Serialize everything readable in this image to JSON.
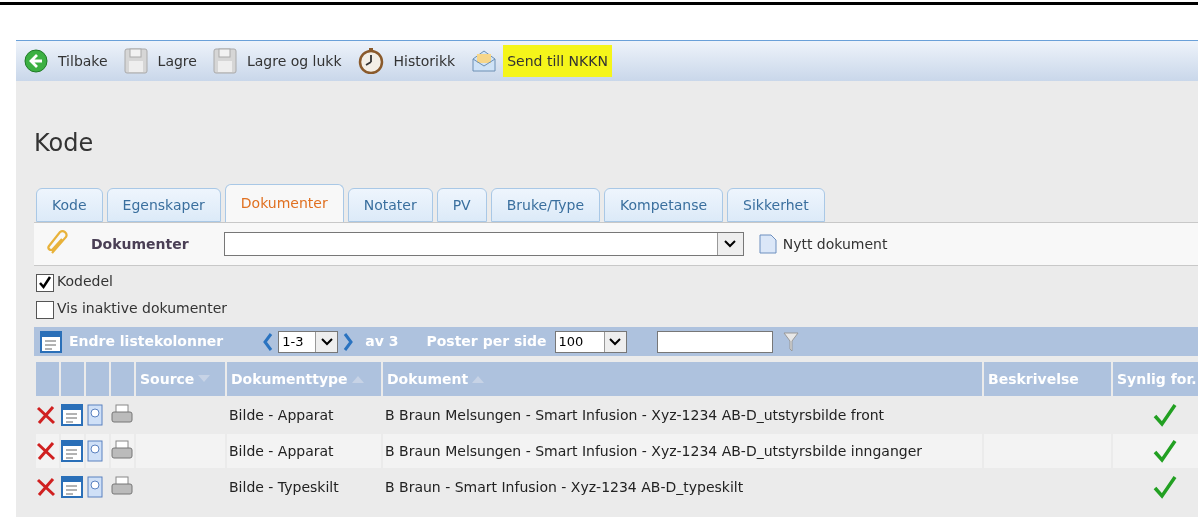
{
  "toolbar": [
    {
      "kind": "back",
      "label": "Tilbake",
      "highlighted": false
    },
    {
      "kind": "save",
      "label": "Lagre",
      "highlighted": false
    },
    {
      "kind": "save",
      "label": "Lagre og lukk",
      "highlighted": false
    },
    {
      "kind": "history",
      "label": "Historikk",
      "highlighted": false
    },
    {
      "kind": "mail",
      "label": "Send till NKKN",
      "highlighted": true
    }
  ],
  "page_title": "Kode",
  "tabs": [
    {
      "label": "Kode",
      "selected": false
    },
    {
      "label": "Egenskaper",
      "selected": false
    },
    {
      "label": "Dokumenter",
      "selected": true
    },
    {
      "label": "Notater",
      "selected": false
    },
    {
      "label": "PV",
      "selected": false
    },
    {
      "label": "Bruke/Type",
      "selected": false
    },
    {
      "label": "Kompetanse",
      "selected": false
    },
    {
      "label": "Sikkerhet",
      "selected": false
    }
  ],
  "documents_bar": {
    "label": "Dokumenter",
    "new_document": "Nytt dokument"
  },
  "checkboxes": [
    {
      "label": "Kodedel",
      "checked": true
    },
    {
      "label": "Vis inaktive dokumenter",
      "checked": false
    }
  ],
  "list_bar": {
    "edit_columns": "Endre listekolonner",
    "page_range": "1-3",
    "of_total": "av 3",
    "per_page_label": "Poster per side",
    "per_page": "100"
  },
  "table": {
    "columns": [
      {
        "label": "Source",
        "sort_ascending": false,
        "sort_descending": true
      },
      {
        "label": "Dokumenttype",
        "sort_ascending": true,
        "sort_descending": false
      },
      {
        "label": "Dokument",
        "sort_ascending": true,
        "sort_descending": false
      },
      {
        "label": "Beskrivelse",
        "sort_ascending": false,
        "sort_descending": false
      },
      {
        "label": "Synlig for.",
        "sort_ascending": false,
        "sort_descending": false
      }
    ],
    "rows": [
      {
        "type": "Bilde - Apparat",
        "document": "B Braun Melsungen - Smart Infusion - Xyz-1234 AB-D_utstyrsbilde front",
        "visible": true
      },
      {
        "type": "Bilde - Apparat",
        "document": "B Braun Melsungen - Smart Infusion - Xyz-1234 AB-D_utstyrsbilde innganger",
        "visible": true
      },
      {
        "type": "Bilde - Typeskilt",
        "document": "B Braun - Smart Infusion - Xyz-1234 AB-D_typeskilt",
        "visible": true
      }
    ]
  }
}
